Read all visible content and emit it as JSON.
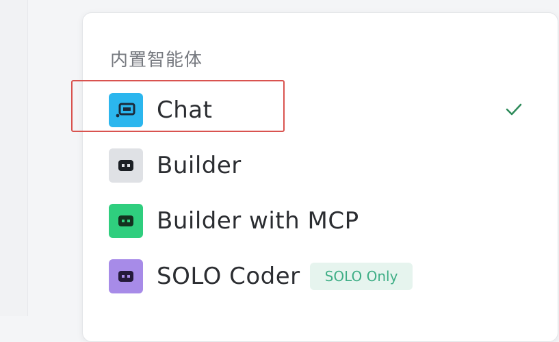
{
  "menu": {
    "section_title": "内置智能体",
    "items": [
      {
        "label": "Chat",
        "icon": "chat-bot-icon",
        "color": "#2bb6ee",
        "selected": true,
        "badge": ""
      },
      {
        "label": "Builder",
        "icon": "builder-bot-icon",
        "color": "#dfe1e5",
        "selected": false,
        "badge": ""
      },
      {
        "label": "Builder with MCP",
        "icon": "builder-mcp-bot-icon",
        "color": "#2fce7e",
        "selected": false,
        "badge": ""
      },
      {
        "label": "SOLO Coder",
        "icon": "solo-coder-bot-icon",
        "color": "#a78be8",
        "selected": false,
        "badge": "SOLO Only"
      }
    ]
  },
  "colors": {
    "highlight": "#d9534f",
    "check": "#2e8b5a",
    "badge_bg": "#e6f4ee",
    "badge_text": "#3fae86"
  }
}
